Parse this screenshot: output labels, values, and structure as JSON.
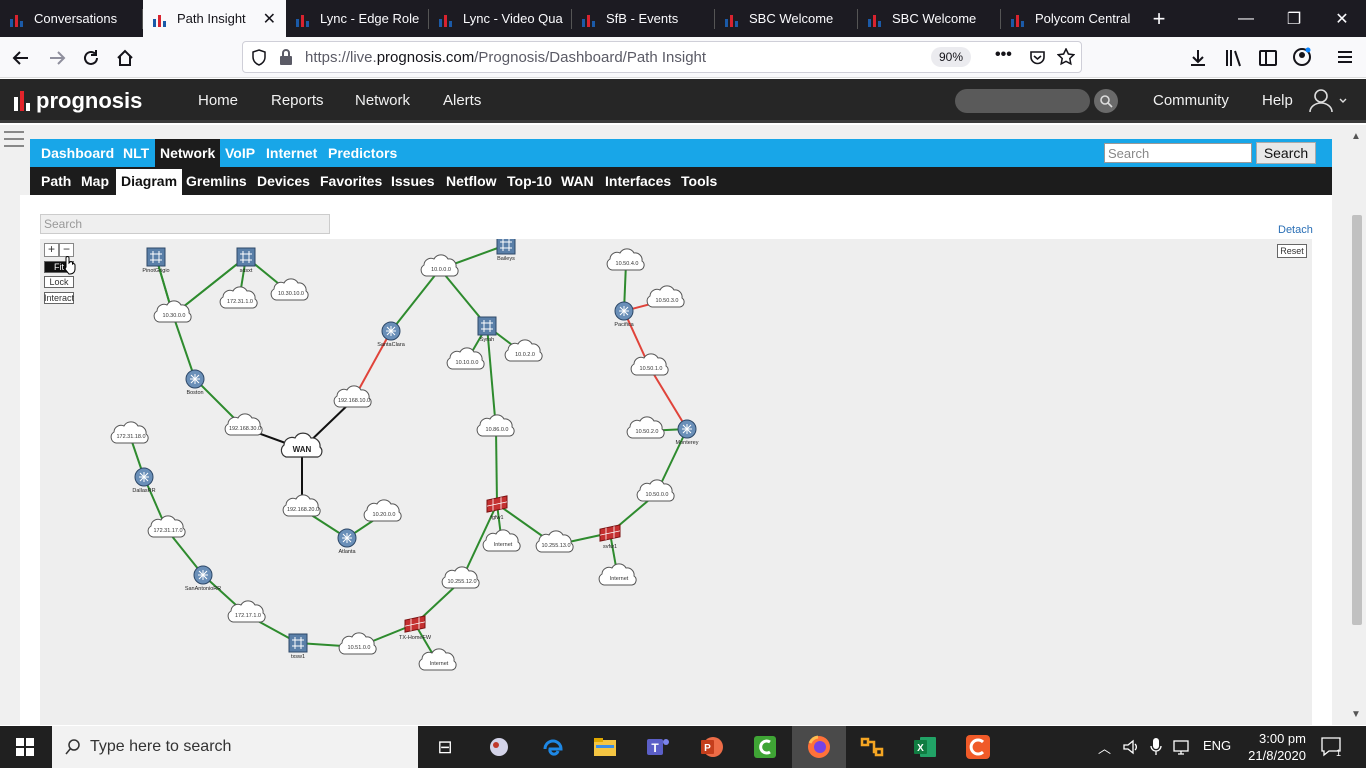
{
  "browser": {
    "tabs": [
      {
        "label": "Conversations",
        "active": false
      },
      {
        "label": "Path Insight",
        "active": true
      },
      {
        "label": "Lync - Edge Role",
        "active": false
      },
      {
        "label": "Lync - Video Qua",
        "active": false
      },
      {
        "label": "SfB - Events",
        "active": false
      },
      {
        "label": "SBC Welcome",
        "active": false
      },
      {
        "label": "SBC Welcome",
        "active": false
      },
      {
        "label": "Polycom Central",
        "active": false
      }
    ],
    "url_prefix": "https://live.",
    "url_domain": "prognosis.com",
    "url_path": "/Prognosis/Dashboard/Path Insight",
    "zoom": "90%"
  },
  "app": {
    "logo": "prognosis",
    "nav": [
      "Home",
      "Reports",
      "Network",
      "Alerts"
    ],
    "right_nav": [
      "Community",
      "Help"
    ]
  },
  "menu1": {
    "items": [
      "Dashboard",
      "NLT",
      "Network",
      "VoIP",
      "Internet",
      "Predictors"
    ],
    "selected": "Network",
    "search_placeholder": "Search",
    "search_button": "Search"
  },
  "menu2": {
    "items": [
      "Path",
      "Map",
      "Diagram",
      "Gremlins",
      "Devices",
      "Favorites",
      "Issues",
      "Netflow",
      "Top-10",
      "WAN",
      "Interfaces",
      "Tools"
    ],
    "selected": "Diagram"
  },
  "diagram": {
    "search_placeholder": "Search",
    "detach": "Detach",
    "reset": "Reset",
    "zoom_in": "+",
    "zoom_out": "−",
    "fit": "Fit",
    "lock": "Lock",
    "interact": "Interact",
    "nodes": [
      {
        "id": "pinotgrigio",
        "type": "switch",
        "label": "PinotGrigio"
      },
      {
        "id": "sydney",
        "type": "switch",
        "label": "sdsxt"
      },
      {
        "id": "baileys",
        "type": "switch",
        "label": "Baileys"
      },
      {
        "id": "syrah",
        "type": "switch",
        "label": "Syrah"
      },
      {
        "id": "txsw1",
        "type": "switch",
        "label": "txsw1"
      },
      {
        "id": "santaclara",
        "type": "router",
        "label": "SantaClara"
      },
      {
        "id": "boston",
        "type": "router",
        "label": "Boston"
      },
      {
        "id": "pacifica",
        "type": "router",
        "label": "Pacifica"
      },
      {
        "id": "monterey",
        "type": "router",
        "label": "Monterey"
      },
      {
        "id": "dallas",
        "type": "router",
        "label": "DallasRR"
      },
      {
        "id": "atlanta",
        "type": "router",
        "label": "Atlanta"
      },
      {
        "id": "sanantonio",
        "type": "router",
        "label": "SanAntonioRR"
      },
      {
        "id": "fgfw1",
        "type": "firewall",
        "label": "fgfw1"
      },
      {
        "id": "svfw1",
        "type": "firewall",
        "label": "svfw1"
      },
      {
        "id": "txhome",
        "type": "firewall",
        "label": "TX-HomeFW"
      },
      {
        "id": "wan",
        "type": "wan",
        "label": "WAN"
      }
    ],
    "clouds": [
      "10.30.0.0",
      "172.31.1.0",
      "10.30.10.0",
      "10.0.0.0",
      "10.10.0.0",
      "10.0.2.0",
      "192.168.10.0",
      "192.168.30.0",
      "10.86.0.0",
      "10.50.4.0",
      "10.50.3.0",
      "10.50.1.0",
      "10.50.2.0",
      "10.50.0.0",
      "172.31.18.0",
      "172.31.17.0",
      "192.168.20.0",
      "10.20.0.0",
      "Internet",
      "10.255.13.0",
      "Internet",
      "10.255.12.0",
      "172.17.1.0",
      "10.51.0.0",
      "Internet"
    ]
  },
  "taskbar": {
    "search_placeholder": "Type here to search",
    "lang": "ENG",
    "time": "3:00 pm",
    "date": "21/8/2020",
    "notifications": "1"
  }
}
